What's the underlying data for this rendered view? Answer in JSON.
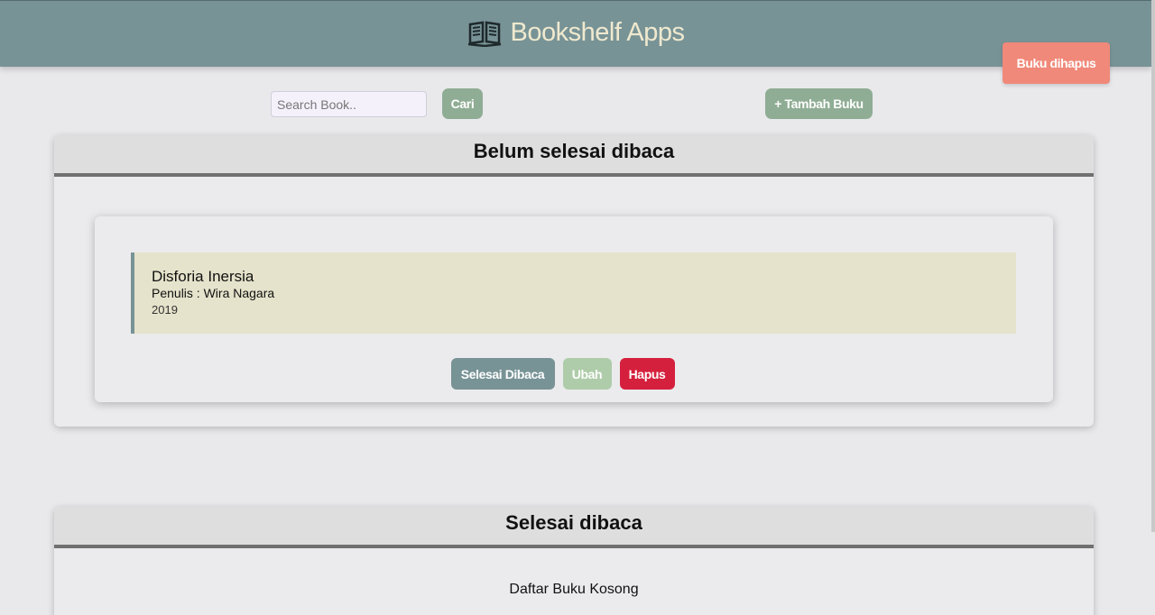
{
  "header": {
    "title": "Bookshelf Apps",
    "icon": "open-book-icon"
  },
  "toolbar": {
    "deleted_label": "Buku dihapus",
    "search_placeholder": "Search Book..",
    "search_button": "Cari",
    "add_button": "+ Tambah Buku"
  },
  "unread": {
    "title": "Belum selesai dibaca",
    "books": [
      {
        "title": "Disforia Inersia",
        "author": "Penulis : Wira Nagara",
        "year": "2019",
        "actions": {
          "done": "Selesai Dibaca",
          "edit": "Ubah",
          "delete": "Hapus"
        }
      }
    ]
  },
  "read": {
    "title": "Selesai dibaca",
    "empty": "Daftar Buku Kosong"
  },
  "colors": {
    "header": "#789396",
    "brand_text": "#efe9cf",
    "accent_green": "#8fad94",
    "deleted_button": "#f0897a",
    "delete_button": "#d5203d",
    "book_background": "#e5e3cb"
  }
}
